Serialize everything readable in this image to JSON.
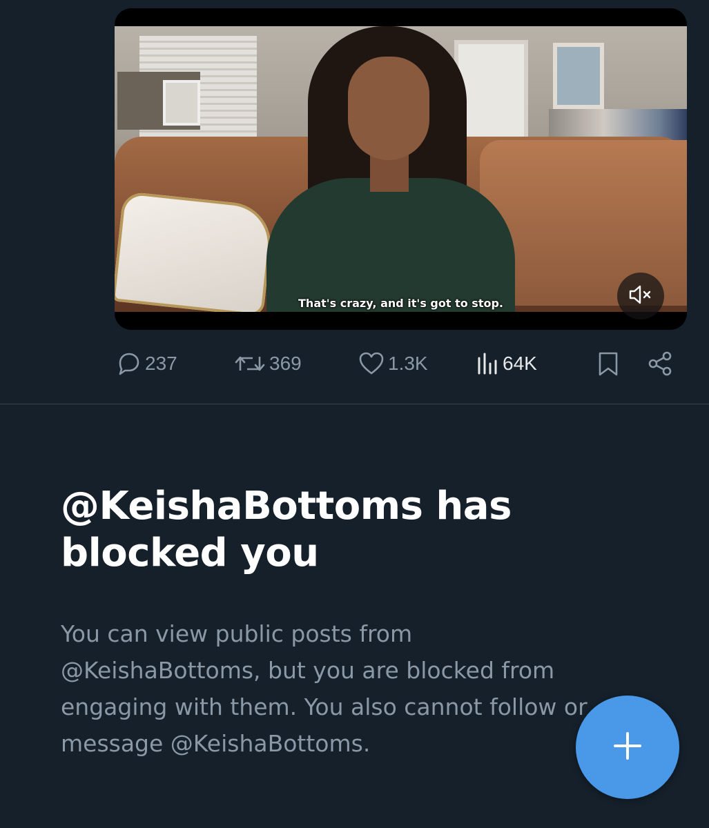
{
  "post": {
    "video": {
      "subtitle": "That's crazy, and it's got to stop.",
      "mute_icon": "speaker-muted-icon"
    },
    "actions": {
      "replies": "237",
      "reposts": "369",
      "likes": "1.3K",
      "views": "64K",
      "icons": [
        "reply-icon",
        "repost-icon",
        "like-icon",
        "views-icon",
        "bookmark-icon",
        "share-icon"
      ]
    }
  },
  "blocked": {
    "title": "@KeishaBottoms has blocked you",
    "body": "You can view public posts from @KeishaBottoms, but you are blocked from engaging with them. You also cannot follow or message @KeishaBottoms."
  },
  "fab": {
    "icon": "plus-icon"
  },
  "colors": {
    "background": "#15202b",
    "secondary_text": "#8b98a5",
    "primary_text": "#ffffff",
    "accent": "#4a99e9",
    "divider": "#38444d"
  }
}
